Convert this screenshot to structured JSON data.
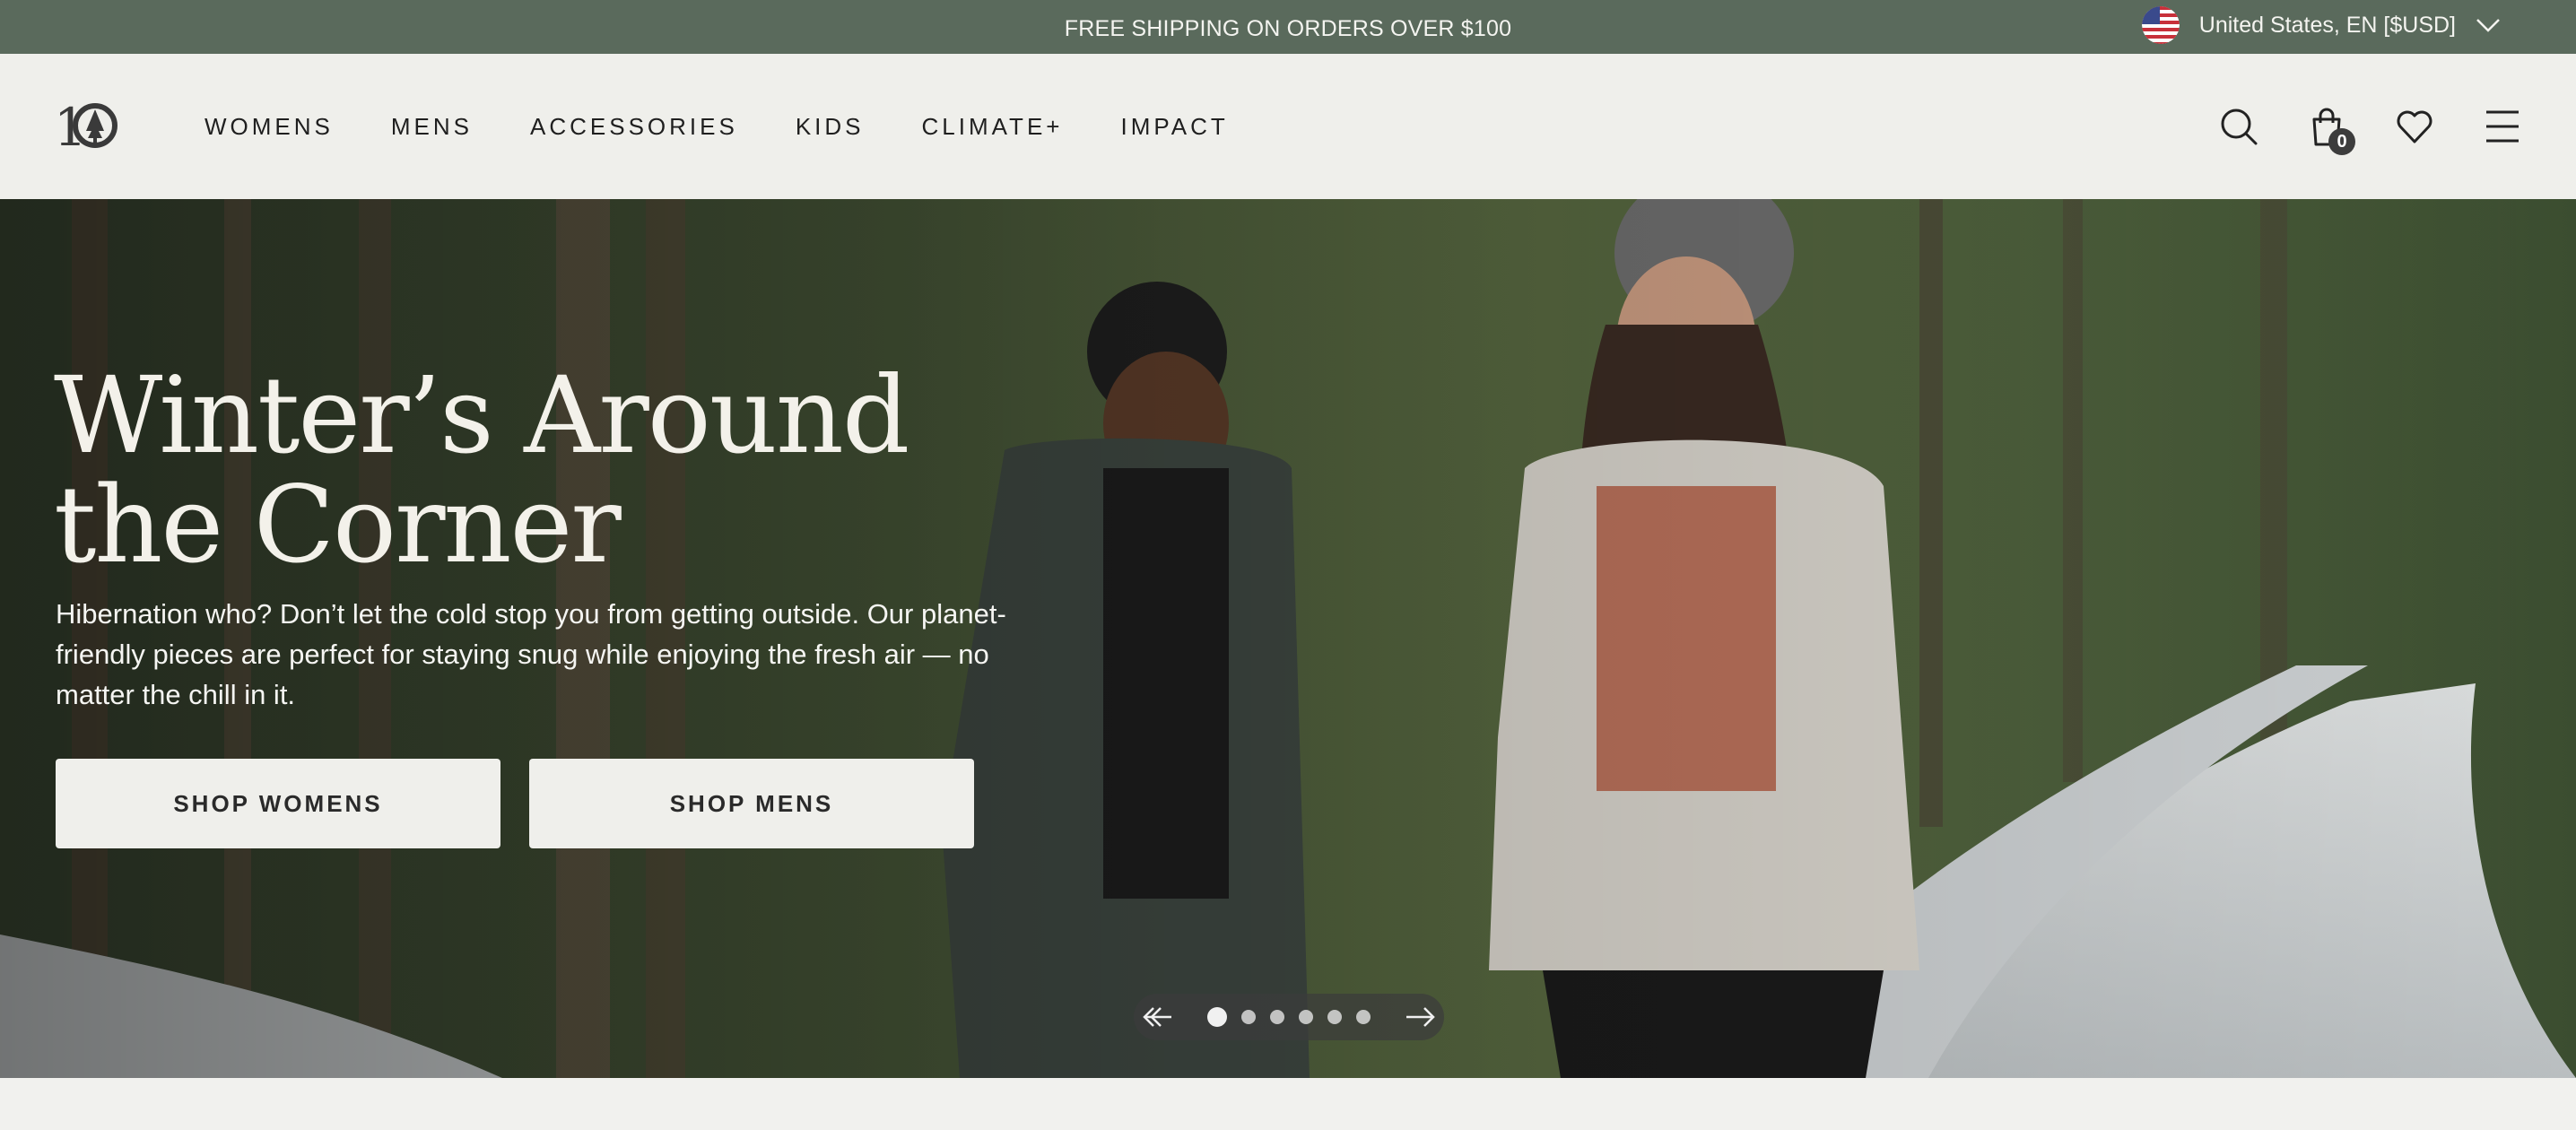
{
  "announcement": {
    "text": "FREE SHIPPING ON ORDERS OVER $100",
    "locale_label": "United States, EN [$USD]",
    "flag_icon": "us-flag-icon"
  },
  "header": {
    "logo_icon": "tentree-logo-icon",
    "nav": [
      {
        "label": "WOMENS"
      },
      {
        "label": "MENS"
      },
      {
        "label": "ACCESSORIES"
      },
      {
        "label": "KIDS"
      },
      {
        "label": "CLIMATE+"
      },
      {
        "label": "IMPACT"
      }
    ],
    "icons": [
      "search-icon",
      "bag-icon",
      "heart-icon",
      "menu-icon"
    ],
    "bag_count": "0"
  },
  "hero": {
    "title_line1": "Winter’s Around",
    "title_line2": "the Corner",
    "description": "Hibernation who? Don’t let the cold stop you from getting outside. Our planet-friendly pieces are perfect for staying snug while enjoying the fresh air — no matter the chill in it.",
    "cta_women": "SHOP WOMENS",
    "cta_men": "SHOP MENS",
    "carousel": {
      "slide_count": 6,
      "active_index": 0
    }
  },
  "colors": {
    "announcement_bg": "#5a6a5c",
    "header_bg": "#efefeb",
    "cta_bg": "#efefeb",
    "hero_text": "#f3f1ea"
  }
}
